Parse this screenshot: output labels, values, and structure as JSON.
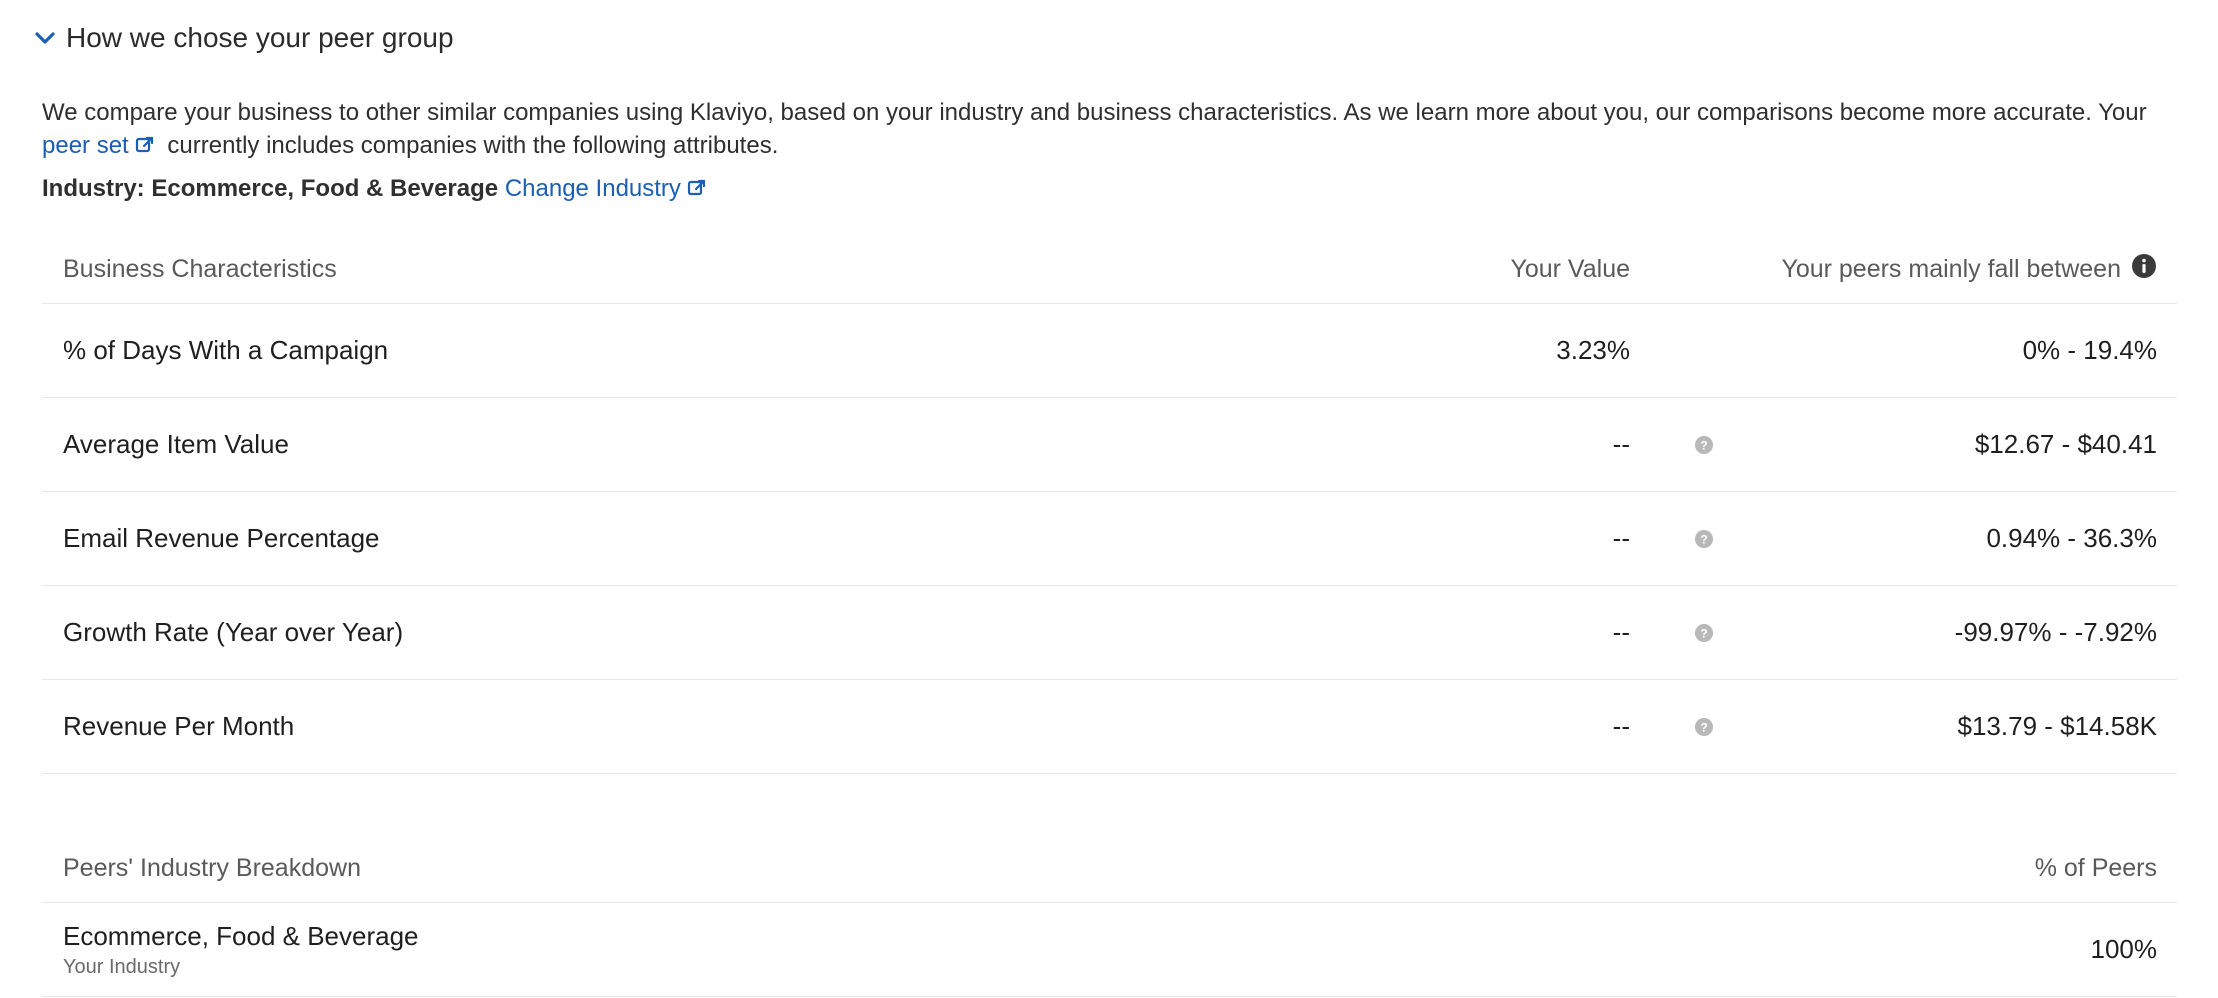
{
  "section": {
    "title": "How we chose your peer group",
    "description_before_link": "We compare your business to other similar companies using Klaviyo, based on your industry and business characteristics. As we learn more about you, our comparisons become more accurate. Your ",
    "peer_set_link": "peer set",
    "description_after_link": " currently includes companies with the following attributes.",
    "industry_label": "Industry: Ecommerce, Food & Beverage",
    "change_industry_link": "Change Industry"
  },
  "characteristics_table": {
    "headers": {
      "name": "Business Characteristics",
      "value": "Your Value",
      "peers": "Your peers mainly fall between"
    },
    "rows": [
      {
        "name": "% of Days With a Campaign",
        "value": "3.23%",
        "peers": "0% - 19.4%"
      },
      {
        "name": "Average Item Value",
        "value": "--",
        "peers": "$12.67 - $40.41"
      },
      {
        "name": "Email Revenue Percentage",
        "value": "--",
        "peers": "0.94% - 36.3%"
      },
      {
        "name": "Growth Rate (Year over Year)",
        "value": "--",
        "peers": "-99.97% - -7.92%"
      },
      {
        "name": "Revenue Per Month",
        "value": "--",
        "peers": "$13.79 - $14.58K"
      }
    ]
  },
  "breakdown_table": {
    "headers": {
      "name": "Peers' Industry Breakdown",
      "percent": "% of Peers"
    },
    "rows": [
      {
        "name": "Ecommerce, Food & Beverage",
        "subtext": "Your Industry",
        "percent": "100%"
      }
    ]
  },
  "colors": {
    "link": "#1a5fb4",
    "border": "#e6e6e6",
    "header_text": "#5a5a5a",
    "help_icon": "#b8b8b8",
    "info_icon": "#3a3a3a"
  },
  "icons": {
    "collapse": "chevron-down-icon",
    "external_link": "external-link-icon",
    "info": "info-circle-icon",
    "help": "question-circle-icon"
  }
}
